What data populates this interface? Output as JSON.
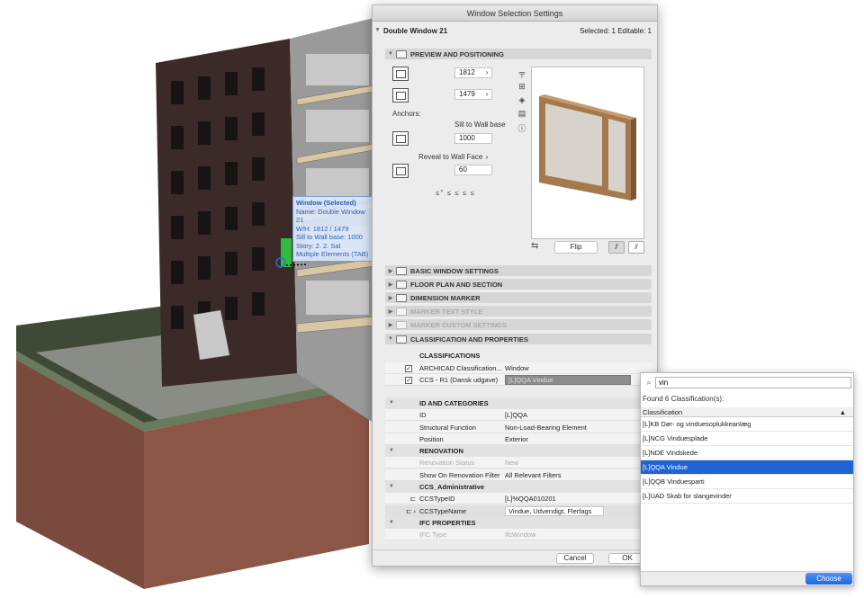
{
  "tooltip": {
    "title": "Window (Selected)",
    "lines": [
      "Name: Double Window 21",
      "W/H: 1812 / 1479",
      "Sill to Wall base: 1000",
      "Story: 2. 2. Sal",
      "Multiple Elements (TAB)"
    ]
  },
  "dialog": {
    "title": "Window Selection Settings",
    "element_name": "Double Window 21",
    "selection_info": "Selected: 1 Editable: 1",
    "sections": {
      "preview": "PREVIEW AND POSITIONING",
      "basic": "BASIC WINDOW SETTINGS",
      "floor_plan": "FLOOR PLAN AND SECTION",
      "dimension": "DIMENSION MARKER",
      "marker_text": "MARKER TEXT STYLE",
      "marker_custom": "MARKER CUSTOM SETTINGS",
      "classification": "CLASSIFICATION AND PROPERTIES"
    },
    "width_value": "1812",
    "height_value": "1479",
    "anchors_label": "Anchors:",
    "sill_label": "Sill to Wall base",
    "sill_value": "1000",
    "reveal_label": "Reveal to Wall Face",
    "reveal_value": "60",
    "anchor_glyphs": "≤° ≤ ≤ ≤ ≤",
    "flip_label": "Flip",
    "chevron": "›",
    "classifications_header": "CLASSIFICATIONS",
    "class_rows": [
      {
        "system": "ARCHICAD Classification...",
        "value": "Window"
      },
      {
        "system": "CCS - R1 (Dansk udgave)",
        "value": "[L]QQA Vindue"
      }
    ],
    "groups": {
      "id": "ID AND CATEGORIES",
      "renovation": "RENOVATION",
      "ccs": "CCS_Administrative",
      "ifc": "IFC PROPERTIES"
    },
    "id_rows": [
      {
        "label": "ID",
        "value": "[L]QQA"
      },
      {
        "label": "Structural Function",
        "value": "Non-Load-Bearing Element"
      },
      {
        "label": "Position",
        "value": "Exterior"
      }
    ],
    "renovation_rows": [
      {
        "label": "Renovation Status",
        "value": "New"
      },
      {
        "label": "Show On Renovation Filter",
        "value": "All Relevant Filters"
      }
    ],
    "ccs_rows": [
      {
        "label": "CCSTypeID",
        "value": "[L]%QQA010201"
      },
      {
        "label": "CCSTypeName",
        "value": "Vindue, Udvendigt, Flerfags"
      }
    ],
    "ifc_rows": [
      {
        "label": "IFC Type",
        "value": "IfcWindow"
      }
    ],
    "cancel_label": "Cancel",
    "ok_label": "OK"
  },
  "popover": {
    "search_value": "vin",
    "found_text": "Found 6 Classification(s):",
    "column_header": "Classification",
    "items": [
      "[L]KB Dør- og vinduesoplukkeanlæg",
      "[L]NCG Vinduesplade",
      "[L]NDE Vindskede",
      "[L]QQA Vindue",
      "[L]QQB Vinduesparti",
      "[L]UAD Skab for slangevinder"
    ],
    "selected_index": 3,
    "choose_label": "Choose"
  },
  "colors": {
    "accent": "#1f63d4",
    "selection_green": "#2ecc40",
    "brick": "#3b2a28"
  }
}
